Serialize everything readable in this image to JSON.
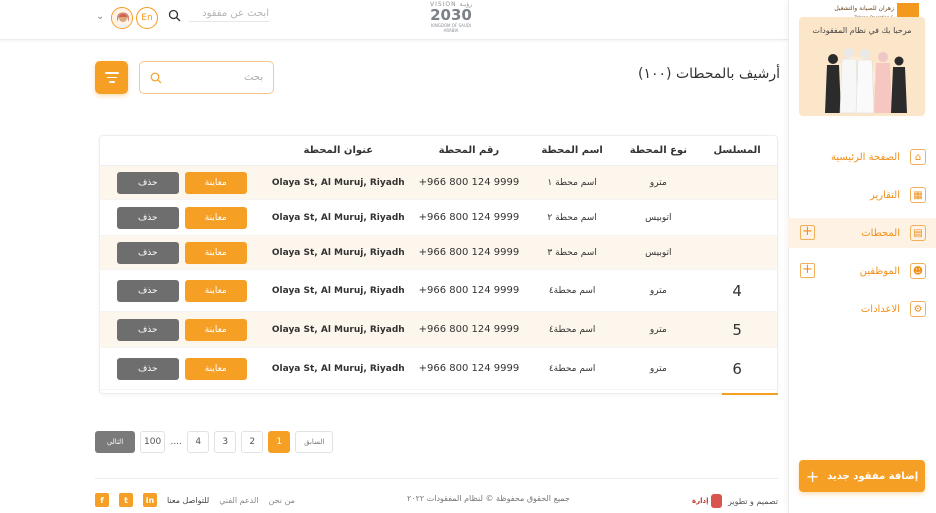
{
  "topbar": {
    "search_placeholder": "ابحث عن مفقود",
    "lang": "En",
    "vision_top": "VISION رؤيـة",
    "vision_year": "2030",
    "vision_sub": "KINGDOM OF SAUDI ARABIA"
  },
  "brand": {
    "logo_ar": "زهران للصيانة والتشغيل",
    "logo_en": "Zahran Operation & Maintenance",
    "logo_mark": "ZOM"
  },
  "sidebar": {
    "welcome": "مرحبا بك في نظام المفقودات",
    "items": [
      {
        "label": "الصفحة الرئيسية",
        "icon": "home-icon"
      },
      {
        "label": "التقارير",
        "icon": "reports-icon"
      },
      {
        "label": "المحطات",
        "icon": "stations-icon",
        "active": true
      },
      {
        "label": "الموظفين",
        "icon": "employees-icon"
      },
      {
        "label": "الاعدادات",
        "icon": "settings-icon"
      }
    ],
    "add_button": "إضافة مفقود جديد"
  },
  "page": {
    "title": "أرشيف بالمحطات (١٠٠)",
    "search_placeholder": "بحث"
  },
  "table": {
    "headers": [
      "المسلسل",
      "نوع المحطة",
      "اسم المحطة",
      "رقم المحطة",
      "عنوان المحطة",
      ""
    ],
    "view_label": "معاينة",
    "delete_label": "حذف",
    "rows": [
      {
        "serial": "",
        "type": "مترو",
        "name": "اسم محطة ١",
        "phone": "+966 800 124 9999",
        "address": "Olaya St, Al Muruj, Riyadh"
      },
      {
        "serial": "",
        "type": "اتوبيس",
        "name": "اسم محطة ٢",
        "phone": "+966 800 124 9999",
        "address": "Olaya St, Al Muruj, Riyadh"
      },
      {
        "serial": "",
        "type": "اتوبيس",
        "name": "اسم محطة ٣",
        "phone": "+966 800 124 9999",
        "address": "Olaya St, Al Muruj, Riyadh"
      },
      {
        "serial": "4",
        "type": "مترو",
        "name": "اسم محطة٤",
        "phone": "+966 800 124 9999",
        "address": "Olaya St, Al Muruj, Riyadh"
      },
      {
        "serial": "5",
        "type": "مترو",
        "name": "اسم محطة٤",
        "phone": "+966 800 124 9999",
        "address": "Olaya St, Al Muruj, Riyadh"
      },
      {
        "serial": "6",
        "type": "مترو",
        "name": "اسم محطة٤",
        "phone": "+966 800 124 9999",
        "address": "Olaya St, Al Muruj, Riyadh"
      }
    ]
  },
  "pagination": {
    "prev": "السابق",
    "next": "التالي",
    "pages": [
      "1",
      "2",
      "3",
      "4",
      "....",
      "100"
    ],
    "current": "1"
  },
  "footer": {
    "design": "تصميم و تطوير",
    "brand": "إدارة",
    "copyright": "جميع الحقوق محفوظة © لنظام المفقودات ٢٠٢٢",
    "links": [
      "من نحن",
      "الدعم الفني",
      "للتواصل معنا"
    ],
    "social": [
      "linkedin-icon",
      "twitter-icon",
      "facebook-icon"
    ]
  },
  "colors": {
    "accent": "#f5a025",
    "delete": "#6e6e6e",
    "row_alt": "#fdf6ec"
  }
}
